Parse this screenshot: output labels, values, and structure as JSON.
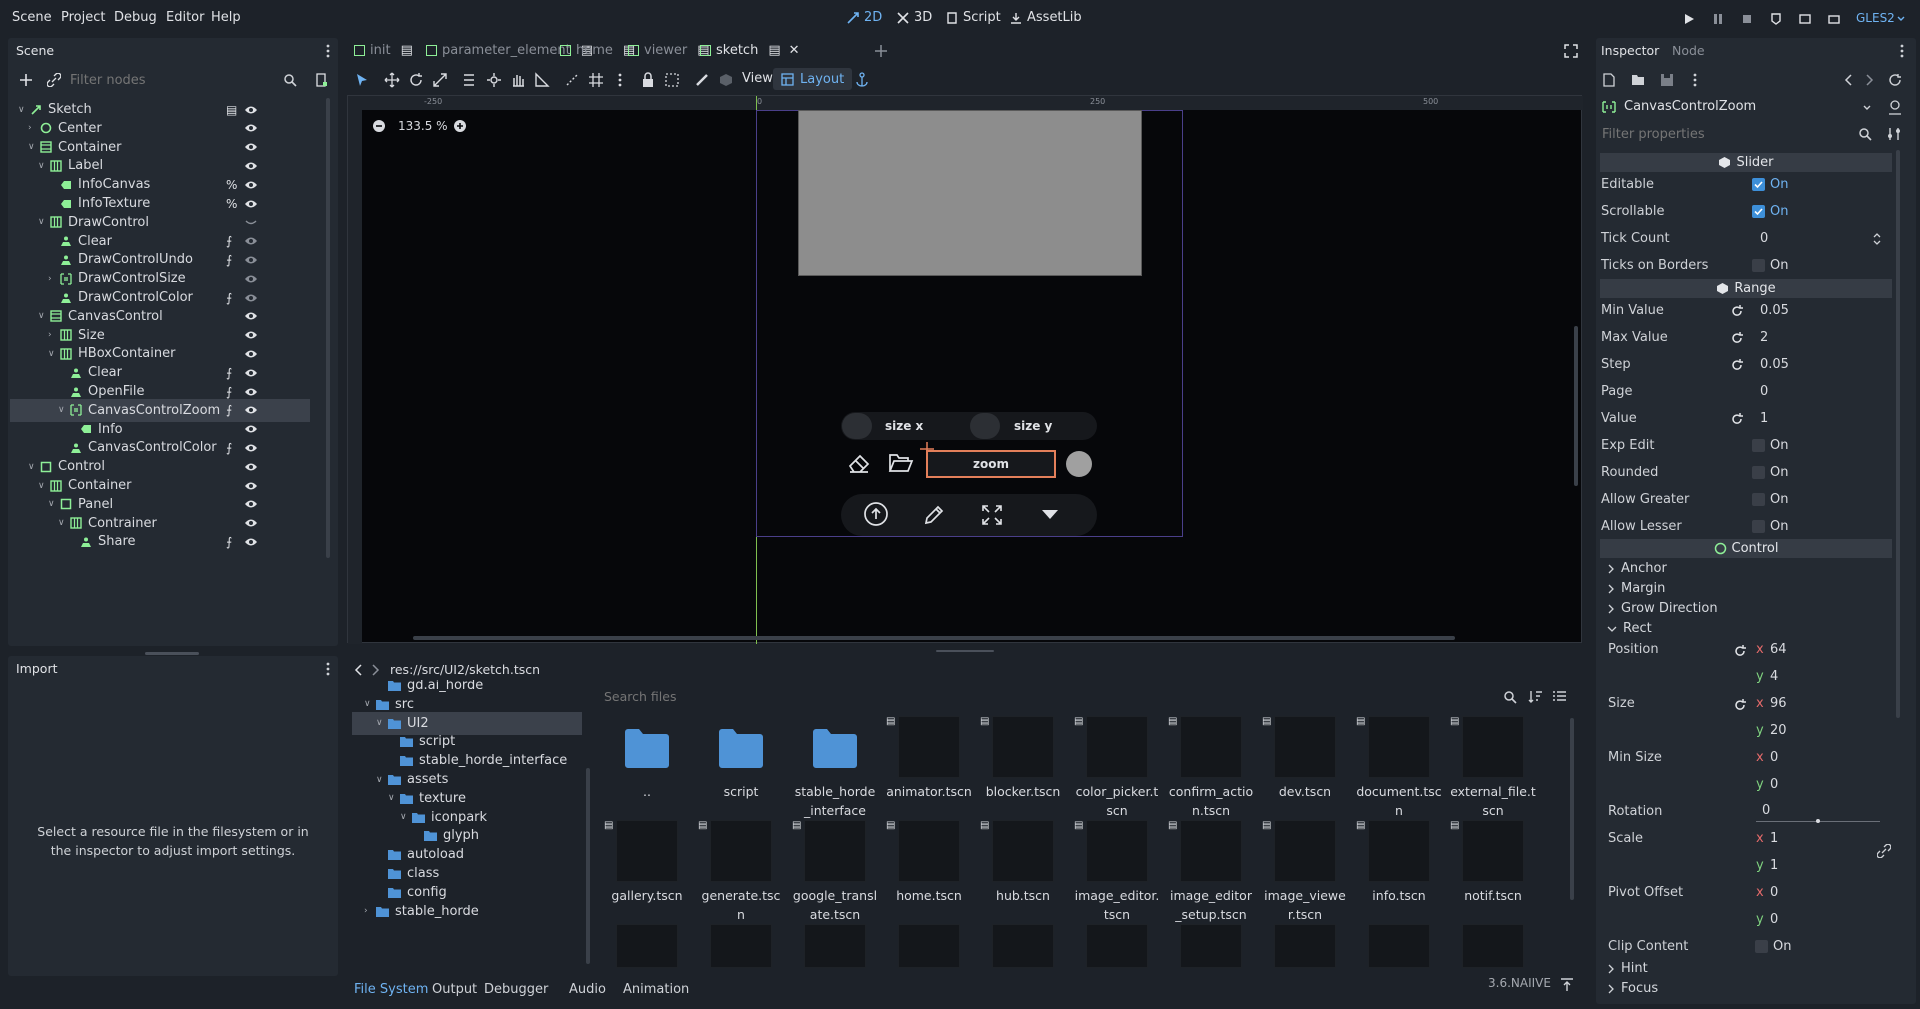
{
  "menu": {
    "items": [
      "Scene",
      "Project",
      "Debug",
      "Editor",
      "Help"
    ]
  },
  "modes": {
    "m2d": "2D",
    "m3d": "3D",
    "script": "Script",
    "assetlib": "AssetLib"
  },
  "renderer": "GLES2",
  "scene_panel": {
    "tab": "Scene",
    "filter_placeholder": "Filter nodes",
    "nodes": [
      {
        "label": "Sketch",
        "indent": 0,
        "arrow": "open",
        "icon": "node2d",
        "color": "#8eef97",
        "signal": "script",
        "eye": true
      },
      {
        "label": "Center",
        "indent": 1,
        "arrow": "closed",
        "icon": "circle",
        "color": "#8eef97",
        "eye": true
      },
      {
        "label": "Container",
        "indent": 1,
        "arrow": "open",
        "icon": "container",
        "color": "#8eef97",
        "eye": true
      },
      {
        "label": "Label",
        "indent": 2,
        "arrow": "open",
        "icon": "grid",
        "color": "#8eef97",
        "eye": true
      },
      {
        "label": "InfoCanvas",
        "indent": 3,
        "icon": "label",
        "color": "#8eef97",
        "signal": "percent",
        "eye": true
      },
      {
        "label": "InfoTexture",
        "indent": 3,
        "icon": "label",
        "color": "#8eef97",
        "signal": "percent",
        "eye": true
      },
      {
        "label": "DrawControl",
        "indent": 2,
        "arrow": "open",
        "icon": "grid",
        "color": "#8eef97",
        "eye": false
      },
      {
        "label": "Clear",
        "indent": 3,
        "icon": "button",
        "color": "#8eef97",
        "signal": "rss",
        "eye": true,
        "dim": true
      },
      {
        "label": "DrawControlUndo",
        "indent": 3,
        "icon": "button",
        "color": "#8eef97",
        "signal": "rss",
        "eye": true,
        "dim": true
      },
      {
        "label": "DrawControlSize",
        "indent": 3,
        "arrow": "closed",
        "icon": "hbox",
        "color": "#8eef97",
        "eye": true,
        "dim": true
      },
      {
        "label": "DrawControlColor",
        "indent": 3,
        "icon": "button",
        "color": "#8eef97",
        "signal": "rss",
        "eye": true,
        "dim": true
      },
      {
        "label": "CanvasControl",
        "indent": 2,
        "arrow": "open",
        "icon": "container",
        "color": "#8eef97",
        "eye": true
      },
      {
        "label": "Size",
        "indent": 3,
        "arrow": "closed",
        "icon": "grid",
        "color": "#8eef97",
        "eye": true
      },
      {
        "label": "HBoxContainer",
        "indent": 3,
        "arrow": "open",
        "icon": "grid",
        "color": "#8eef97",
        "eye": true
      },
      {
        "label": "Clear",
        "indent": 4,
        "icon": "button",
        "color": "#8eef97",
        "signal": "rss",
        "eye": true
      },
      {
        "label": "OpenFile",
        "indent": 4,
        "icon": "button",
        "color": "#8eef97",
        "signal": "rss",
        "eye": true
      },
      {
        "label": "CanvasControlZoom",
        "indent": 4,
        "arrow": "open",
        "icon": "hbox",
        "color": "#8eef97",
        "signal": "rss",
        "eye": true,
        "selected": true
      },
      {
        "label": "Info",
        "indent": 5,
        "icon": "label",
        "color": "#8eef97",
        "eye": true
      },
      {
        "label": "CanvasControlColor",
        "indent": 4,
        "icon": "button",
        "color": "#8eef97",
        "signal": "rss",
        "eye": true
      },
      {
        "label": "Control",
        "indent": 1,
        "arrow": "open",
        "icon": "square",
        "color": "#8eef97",
        "eye": true
      },
      {
        "label": "Container",
        "indent": 2,
        "arrow": "open",
        "icon": "grid",
        "color": "#8eef97",
        "eye": true
      },
      {
        "label": "Panel",
        "indent": 3,
        "arrow": "open",
        "icon": "square",
        "color": "#8eef97",
        "eye": true
      },
      {
        "label": "Contrainer",
        "indent": 4,
        "arrow": "open",
        "icon": "grid",
        "color": "#8eef97",
        "eye": true
      },
      {
        "label": "Share",
        "indent": 5,
        "icon": "button",
        "color": "#8eef97",
        "signal": "rss",
        "eye": true
      }
    ]
  },
  "import_panel": {
    "tab": "Import",
    "message": "Select a resource file in the filesystem or in the inspector to adjust import settings."
  },
  "editor_tabs": [
    "init",
    "parameter_element",
    "home",
    "viewer",
    "sketch"
  ],
  "viewport": {
    "zoom": "133.5 %",
    "view_label": "View",
    "layout_label": "Layout",
    "ruler_marks": [
      "-250",
      "0",
      "250",
      "500"
    ],
    "ui_buttons": {
      "size_x": "size x",
      "size_y": "size y",
      "zoom": "zoom"
    }
  },
  "filesystem": {
    "path": "res://src/UI2/sketch.tscn",
    "search_placeholder": "Search files",
    "tree": [
      {
        "label": "gd.ai_horde",
        "indent": 1
      },
      {
        "label": "src",
        "indent": 0,
        "arrow": "open"
      },
      {
        "label": "UI2",
        "indent": 1,
        "arrow": "open",
        "selected": true
      },
      {
        "label": "script",
        "indent": 2
      },
      {
        "label": "stable_horde_interface",
        "indent": 2
      },
      {
        "label": "assets",
        "indent": 1,
        "arrow": "open"
      },
      {
        "label": "texture",
        "indent": 2,
        "arrow": "open"
      },
      {
        "label": "iconpark",
        "indent": 3,
        "arrow": "open"
      },
      {
        "label": "glyph",
        "indent": 4
      },
      {
        "label": "autoload",
        "indent": 1
      },
      {
        "label": "class",
        "indent": 1
      },
      {
        "label": "config",
        "indent": 1
      },
      {
        "label": "stable_horde",
        "indent": 0,
        "arrow": "closed"
      }
    ],
    "files_row1": [
      "..",
      "script",
      "stable_horde_interface",
      "animator.tscn",
      "blocker.tscn",
      "color_picker.tscn",
      "confirm_action.tscn",
      "dev.tscn",
      "document.tscn",
      "external_file.tscn"
    ],
    "files_row2": [
      "gallery.tscn",
      "generate.tscn",
      "google_translate.tscn",
      "home.tscn",
      "hub.tscn",
      "image_editor.tscn",
      "image_editor_setup.tscn",
      "image_viewer.tscn",
      "info.tscn",
      "notif.tscn"
    ]
  },
  "bottom_tabs": [
    "File System",
    "Output",
    "Debugger",
    "Audio",
    "Animation"
  ],
  "version": "3.6.NAIIVE",
  "inspector": {
    "tabs": {
      "inspector": "Inspector",
      "node": "Node"
    },
    "object": "CanvasControlZoom",
    "filter_placeholder": "Filter properties",
    "sections": {
      "slider": "Slider",
      "range": "Range",
      "control": "Control"
    },
    "props": {
      "editable": {
        "label": "Editable",
        "value": "On"
      },
      "scrollable": {
        "label": "Scrollable",
        "value": "On"
      },
      "tick_count": {
        "label": "Tick Count",
        "value": "0"
      },
      "ticks_on_borders": {
        "label": "Ticks on Borders",
        "value": "On"
      },
      "min_value": {
        "label": "Min Value",
        "value": "0.05"
      },
      "max_value": {
        "label": "Max Value",
        "value": "2"
      },
      "step": {
        "label": "Step",
        "value": "0.05"
      },
      "page": {
        "label": "Page",
        "value": "0"
      },
      "value": {
        "label": "Value",
        "value": "1"
      },
      "exp_edit": {
        "label": "Exp Edit",
        "value": "On"
      },
      "rounded": {
        "label": "Rounded",
        "value": "On"
      },
      "allow_greater": {
        "label": "Allow Greater",
        "value": "On"
      },
      "allow_lesser": {
        "label": "Allow Lesser",
        "value": "On"
      }
    },
    "groups": {
      "anchor": "Anchor",
      "margin": "Margin",
      "grow": "Grow Direction",
      "rect": "Rect",
      "hint": "Hint",
      "focus": "Focus"
    },
    "rect": {
      "position_label": "Position",
      "pos_x": "64",
      "pos_y": "4",
      "size_label": "Size",
      "size_x": "96",
      "size_y": "20",
      "min_size_label": "Min Size",
      "min_x": "0",
      "min_y": "0",
      "rotation_label": "Rotation",
      "rotation": "0",
      "scale_label": "Scale",
      "scale_x": "1",
      "scale_y": "1",
      "pivot_label": "Pivot Offset",
      "pivot_x": "0",
      "pivot_y": "0",
      "clip_label": "Clip Content",
      "clip_value": "On"
    },
    "axis": {
      "x": "x",
      "y": "y"
    }
  }
}
